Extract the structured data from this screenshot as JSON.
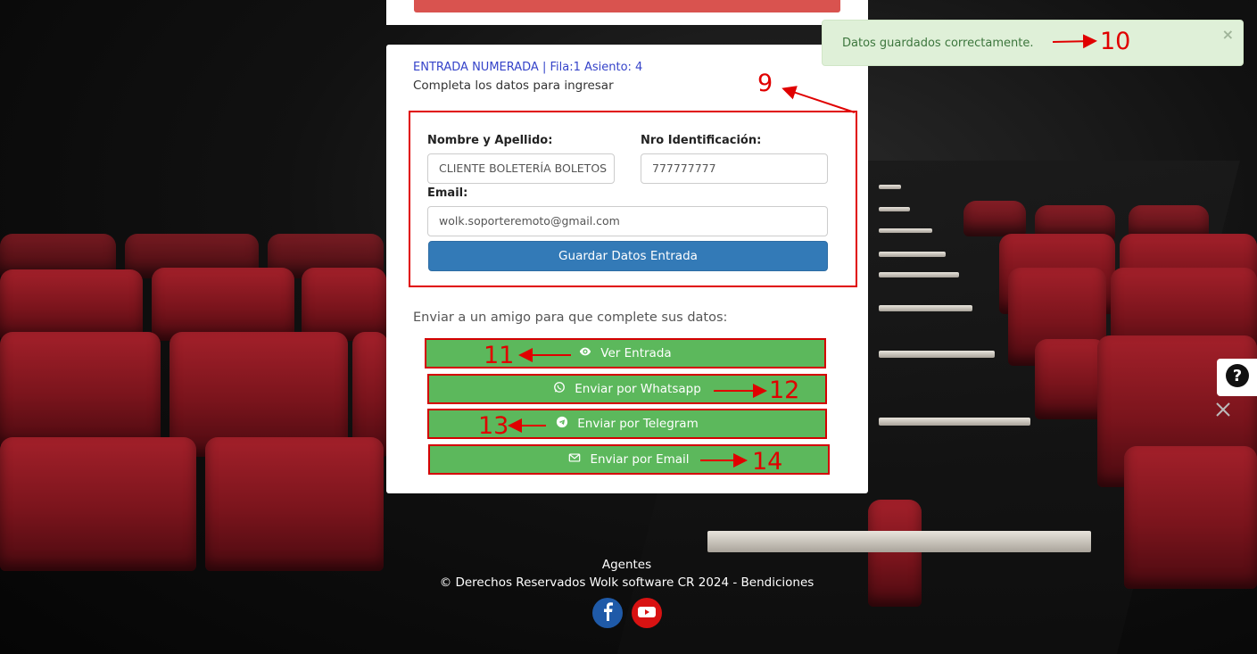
{
  "ticket": {
    "title": "ENTRADA NUMERADA | Fila:1 Asiento: 4",
    "subtitle": "Completa los datos para ingresar"
  },
  "form": {
    "name_label": "Nombre y Apellido:",
    "name_value": "CLIENTE BOLETERÍA BOLETOS",
    "id_label": "Nro Identificación:",
    "id_value": "777777777",
    "email_label": "Email:",
    "email_value": "wolk.soporteremoto@gmail.com",
    "save_label": "Guardar Datos Entrada"
  },
  "share": {
    "intro": "Enviar a un amigo para que complete sus datos:",
    "view_label": "Ver Entrada",
    "whatsapp_label": "Enviar por Whatsapp",
    "telegram_label": "Enviar por Telegram",
    "email_label": "Enviar por Email"
  },
  "toast": {
    "message": "Datos guardados correctamente.",
    "close": "×"
  },
  "annotations": {
    "n9": "9",
    "n10": "10",
    "n11": "11",
    "n12": "12",
    "n13": "13",
    "n14": "14"
  },
  "footer": {
    "line1": "Agentes",
    "line2": "©  Derechos Reservados Wolk software CR  2024 - Bendiciones"
  },
  "icons": {
    "view": "eye-icon",
    "whatsapp": "whatsapp-icon",
    "telegram": "telegram-icon",
    "email": "envelope-icon",
    "help": "question-circle-icon",
    "facebook": "facebook-icon",
    "youtube": "youtube-icon"
  },
  "colors": {
    "primary_button": "#337ab7",
    "success_button": "#5cb85c",
    "annotation": "#e00000",
    "toast_bg": "#dff0d8",
    "ticket_title": "#3543c9"
  }
}
